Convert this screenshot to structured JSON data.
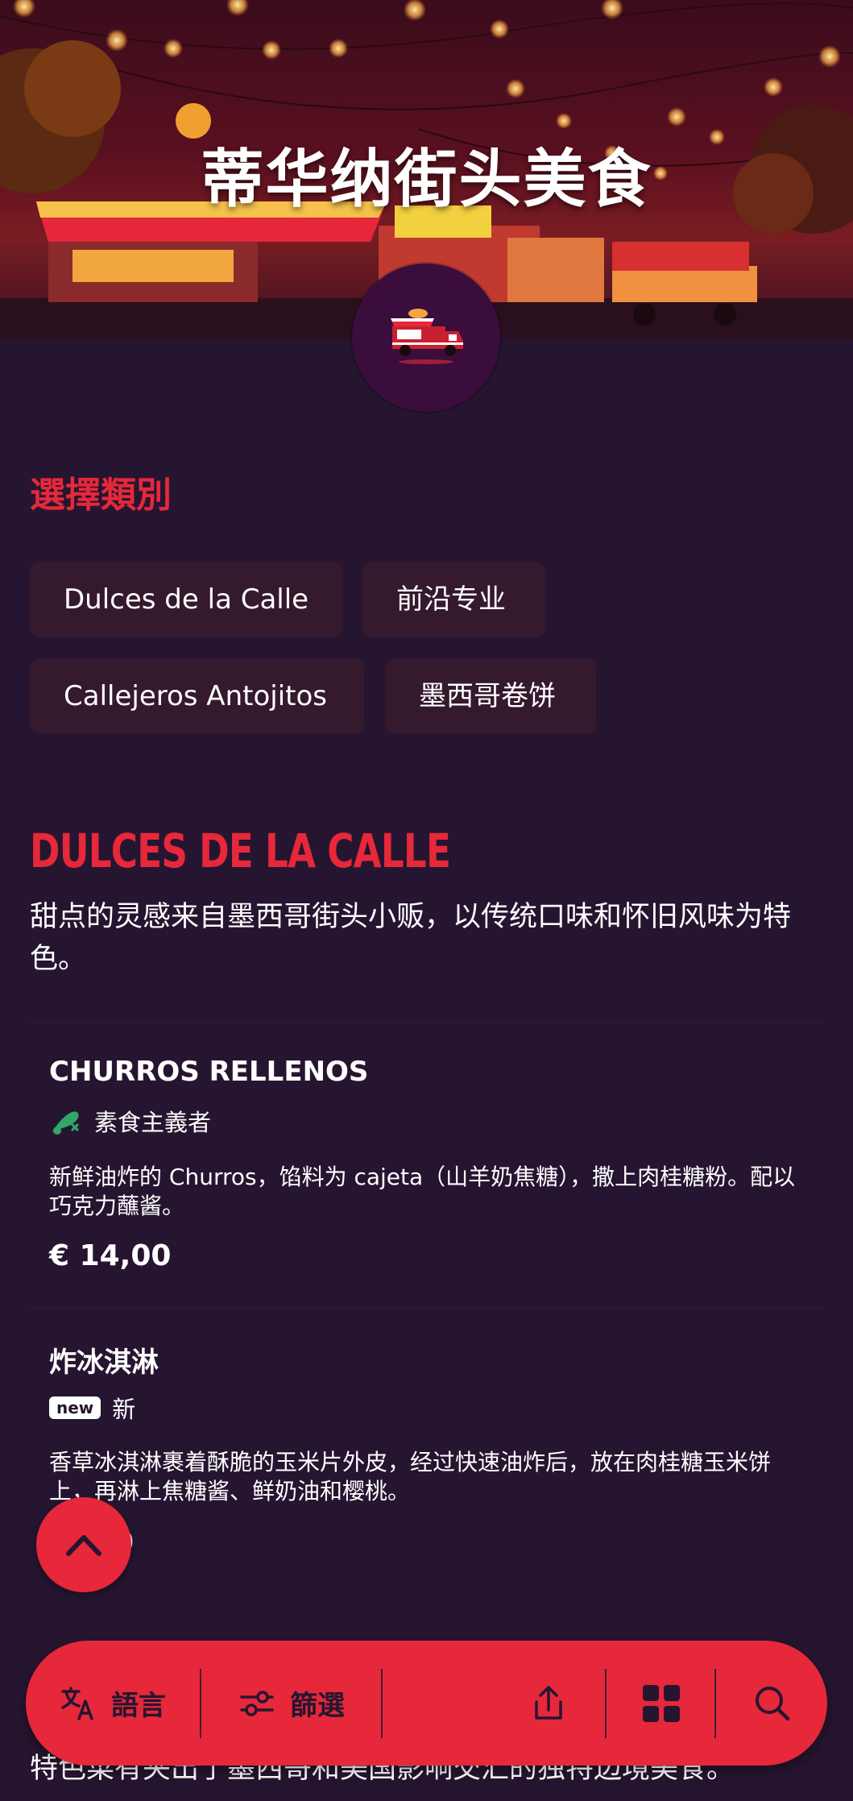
{
  "hero": {
    "title": "蒂华纳街头美食"
  },
  "categories_section": {
    "label": "選擇類別",
    "chips": [
      "Dulces de la Calle",
      "前沿专业",
      "Callejeros Antojitos",
      "墨西哥卷饼"
    ]
  },
  "category": {
    "heading": "DULCES DE LA CALLE",
    "description": "甜点的灵感来自墨西哥街头小贩，以传统口味和怀旧风味为特色。"
  },
  "items": [
    {
      "name": "CHURROS RELLENOS",
      "tag_icon": "vegetarian-icon",
      "tag": "素食主義者",
      "description": "新鲜油炸的 Churros，馅料为 cajeta（山羊奶焦糖），撒上肉桂糖粉。配以巧克力蘸酱。",
      "price": "€ 14,00"
    },
    {
      "name": "炸冰淇淋",
      "badge": "new",
      "tag": "新",
      "description": "香草冰淇淋裹着酥脆的玉米片外皮，经过快速油炸后，放在肉桂糖玉米饼上，再淋上焦糖酱、鲜奶油和樱桃。",
      "price": "0"
    }
  ],
  "next_category_text": "特色菜有夹出了墨西哥和美国影响交汇的独特边境美食。",
  "toolbar": {
    "language_label": "語言",
    "filter_label": "篩選",
    "icons": [
      "translate-icon",
      "filter-icon",
      "share-icon",
      "grid-icon",
      "search-icon"
    ]
  },
  "colors": {
    "background": "#261530",
    "accent": "#e6283a",
    "chip": "#35192d",
    "logo_circle": "#3a0d3d"
  }
}
